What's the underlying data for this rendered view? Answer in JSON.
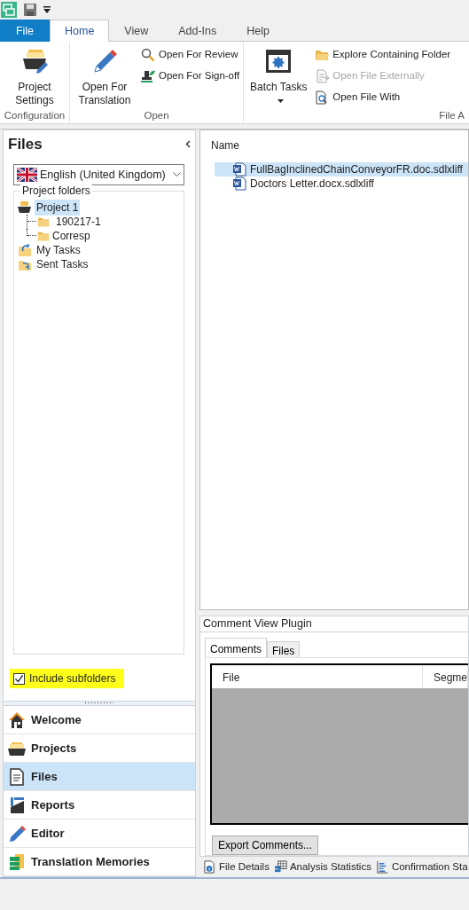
{
  "ribbon": {
    "tabs": [
      {
        "label": "File",
        "kind": "file",
        "selected": false
      },
      {
        "label": "Home",
        "kind": "tab",
        "selected": true
      },
      {
        "label": "View",
        "kind": "tab",
        "selected": false
      },
      {
        "label": "Add-Ins",
        "kind": "tab",
        "selected": false
      },
      {
        "label": "Help",
        "kind": "tab",
        "selected": false
      }
    ],
    "groups": [
      {
        "label": "Configuration",
        "buttons": [
          {
            "label": "Project Settings",
            "kind": "large",
            "disabled": false,
            "dropdown": false
          }
        ]
      },
      {
        "label": "Open",
        "buttons": [
          {
            "label": "Open For Translation",
            "kind": "large",
            "disabled": false,
            "dropdown": false
          },
          {
            "label": "Open For Review",
            "kind": "small",
            "disabled": false,
            "dropdown": false
          },
          {
            "label": "Open For Sign-off",
            "kind": "small",
            "disabled": false,
            "dropdown": false
          }
        ]
      },
      {
        "label": "File A",
        "buttons": [
          {
            "label": "Batch Tasks",
            "kind": "large",
            "disabled": false,
            "dropdown": true
          },
          {
            "label": "Explore Containing Folder",
            "kind": "small",
            "disabled": false,
            "dropdown": false
          },
          {
            "label": "Open File Externally",
            "kind": "small",
            "disabled": true,
            "dropdown": false
          },
          {
            "label": "Open File With",
            "kind": "small",
            "disabled": false,
            "dropdown": false
          }
        ]
      }
    ]
  },
  "files_panel": {
    "title": "Files",
    "language": "English (United Kingdom)",
    "folders_label": "Project folders",
    "tree": [
      {
        "label": "Project 1",
        "selected": true,
        "children": [
          {
            "label": "190217-1",
            "selected": false
          },
          {
            "label": "Corresp",
            "selected": false
          }
        ]
      },
      {
        "label": "My Tasks",
        "selected": false
      },
      {
        "label": "Sent Tasks",
        "selected": false
      }
    ],
    "include_subfolders": {
      "label": "Include subfolders",
      "checked": true,
      "highlighted": true
    }
  },
  "navigation": [
    {
      "label": "Welcome",
      "selected": false
    },
    {
      "label": "Projects",
      "selected": false
    },
    {
      "label": "Files",
      "selected": true
    },
    {
      "label": "Reports",
      "selected": false
    },
    {
      "label": "Editor",
      "selected": false
    },
    {
      "label": "Translation Memories",
      "selected": false
    }
  ],
  "file_list": {
    "column": "Name",
    "rows": [
      {
        "name": "FullBagInclinedChainConveyorFR.doc.sdlxliff",
        "selected": true
      },
      {
        "name": "Doctors Letter.docx.sdlxliff",
        "selected": false
      }
    ]
  },
  "comment_plugin": {
    "title": "Comment View Plugin",
    "tabs": [
      {
        "label": "Comments",
        "selected": true
      },
      {
        "label": "Files",
        "selected": false
      }
    ],
    "columns": [
      "File",
      "Segme"
    ],
    "button": "Export Comments..."
  },
  "bottom_tabs": [
    "File Details",
    "Analysis Statistics",
    "Confirmation Sta"
  ]
}
